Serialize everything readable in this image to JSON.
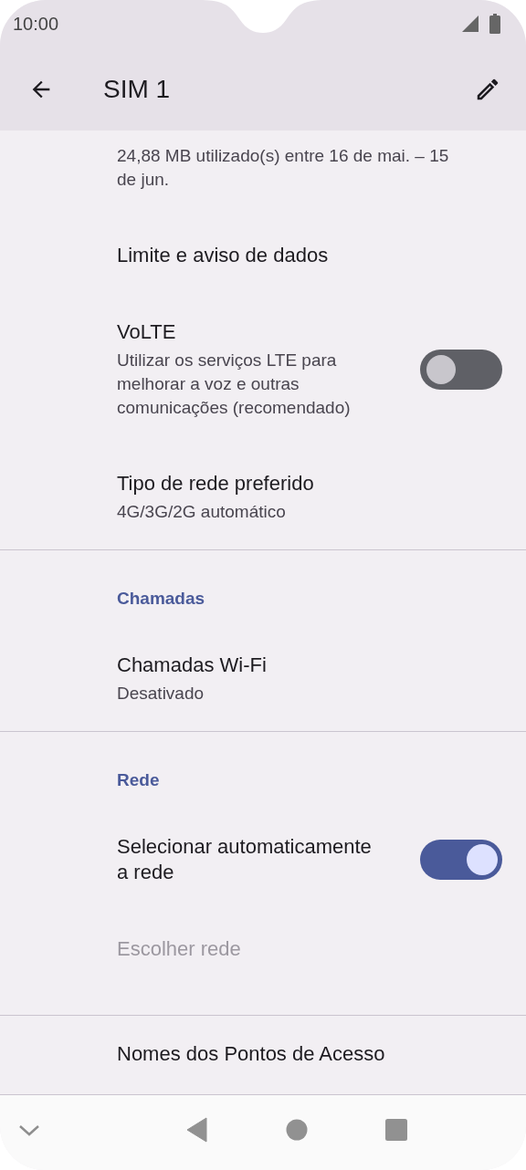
{
  "status_bar": {
    "time": "10:00"
  },
  "app_bar": {
    "title": "SIM 1"
  },
  "sections": [
    {
      "items": [
        {
          "kind": "text",
          "summary": "24,88 MB utilizado(s) entre 16 de mai. – 15 de jun.",
          "disabled": false
        },
        {
          "kind": "text",
          "title": "Limite e aviso de dados",
          "disabled": false
        },
        {
          "kind": "switch",
          "title": "VoLTE",
          "summary": "Utilizar os serviços LTE para melhorar a voz e outras comunicações (recomendado)",
          "on": false,
          "disabled": false
        },
        {
          "kind": "text",
          "title": "Tipo de rede preferido",
          "summary": "4G/3G/2G automático",
          "disabled": false
        }
      ]
    },
    {
      "header": "Chamadas",
      "items": [
        {
          "kind": "text",
          "title": "Chamadas Wi-Fi",
          "summary": "Desativado",
          "disabled": false
        }
      ]
    },
    {
      "header": "Rede",
      "items": [
        {
          "kind": "switch",
          "title": "Selecionar automaticamente a rede",
          "on": true,
          "disabled": false
        },
        {
          "kind": "text",
          "title": "Escolher rede",
          "disabled": true
        }
      ]
    },
    {
      "items": [
        {
          "kind": "text",
          "title": "Nomes dos Pontos de Acesso",
          "disabled": false
        }
      ]
    }
  ]
}
